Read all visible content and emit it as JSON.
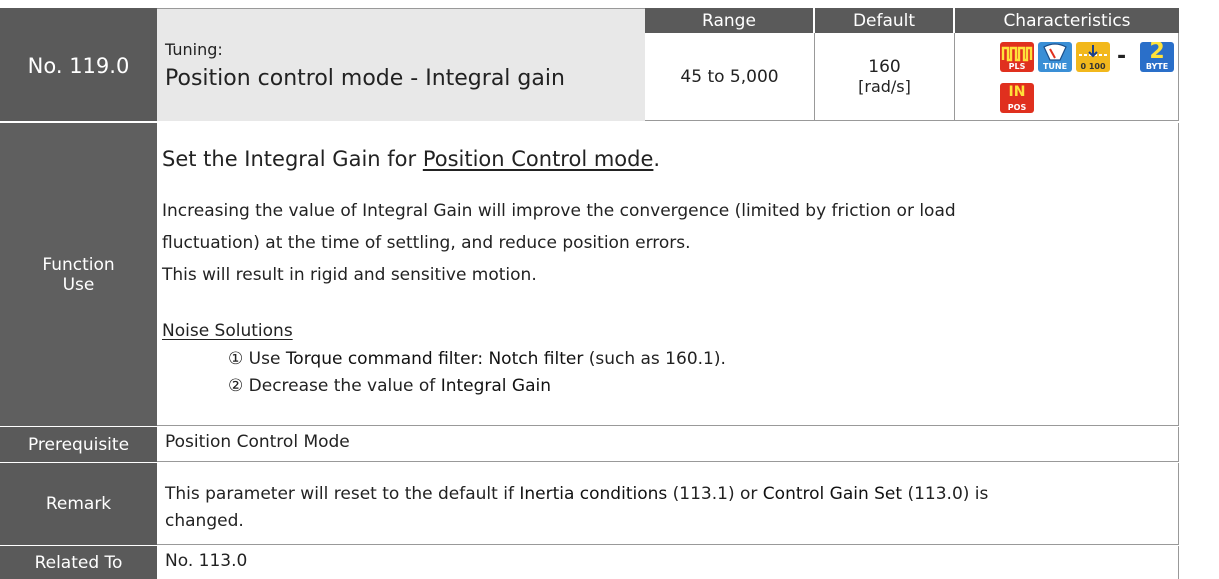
{
  "header": {
    "col_range": "Range",
    "col_default": "Default",
    "col_characteristics": "Characteristics"
  },
  "parameter": {
    "number": "No. 119.0",
    "category": "Tuning:",
    "name": "Position control mode - Integral gain",
    "range": "45 to 5,000",
    "default_value": "160",
    "default_unit": "[rad/s]"
  },
  "characteristics": {
    "icons": [
      {
        "name": "pulse-icon",
        "label": "PLS",
        "color": "#e0301e"
      },
      {
        "name": "tune-icon",
        "label": "TUNE",
        "color": "#3a8fd6"
      },
      {
        "name": "range-icon",
        "label": "0 100",
        "color": "#f2b81c"
      },
      {
        "name": "dash-separator",
        "label": "-"
      },
      {
        "name": "two-byte-icon",
        "label": "BYTE",
        "color": "#2a6fc9"
      },
      {
        "name": "in-position-icon",
        "label": "POS",
        "color": "#e0301e"
      }
    ],
    "dash": "-",
    "two_byte_digit": "2",
    "in_pos_text": "IN"
  },
  "function_use": {
    "label_line1": "Function",
    "label_line2": "Use",
    "heading_pre": "Set the Integral Gain for ",
    "heading_link": "Position Control mode",
    "heading_post": ".",
    "para1_line1": "Increasing the value of Integral Gain will improve the convergence (limited by friction or load",
    "para1_line2": "fluctuation) at the time of settling, and reduce position errors.",
    "para2": "This will result in rigid and sensitive motion.",
    "noise_title": "Noise Solutions",
    "item1_pre": "① Use ",
    "item1_bold": "Torque command filter: Notch filter",
    "item1_post": " (such as 160.1).",
    "item2_pre": "② Decrease the value of ",
    "item2_bold": "Integral Gain"
  },
  "prerequisite": {
    "label": "Prerequisite",
    "value": "Position Control Mode"
  },
  "remark": {
    "label": "Remark",
    "line1_pre": "This parameter will reset to the default if ",
    "line1_b1": "Inertia conditions",
    "line1_mid": " (113.1) or ",
    "line1_b2": "Control Gain Set",
    "line1_post": " (113.0) is",
    "line2": "changed."
  },
  "related": {
    "label": "Related To",
    "value": "No. 113.0"
  }
}
